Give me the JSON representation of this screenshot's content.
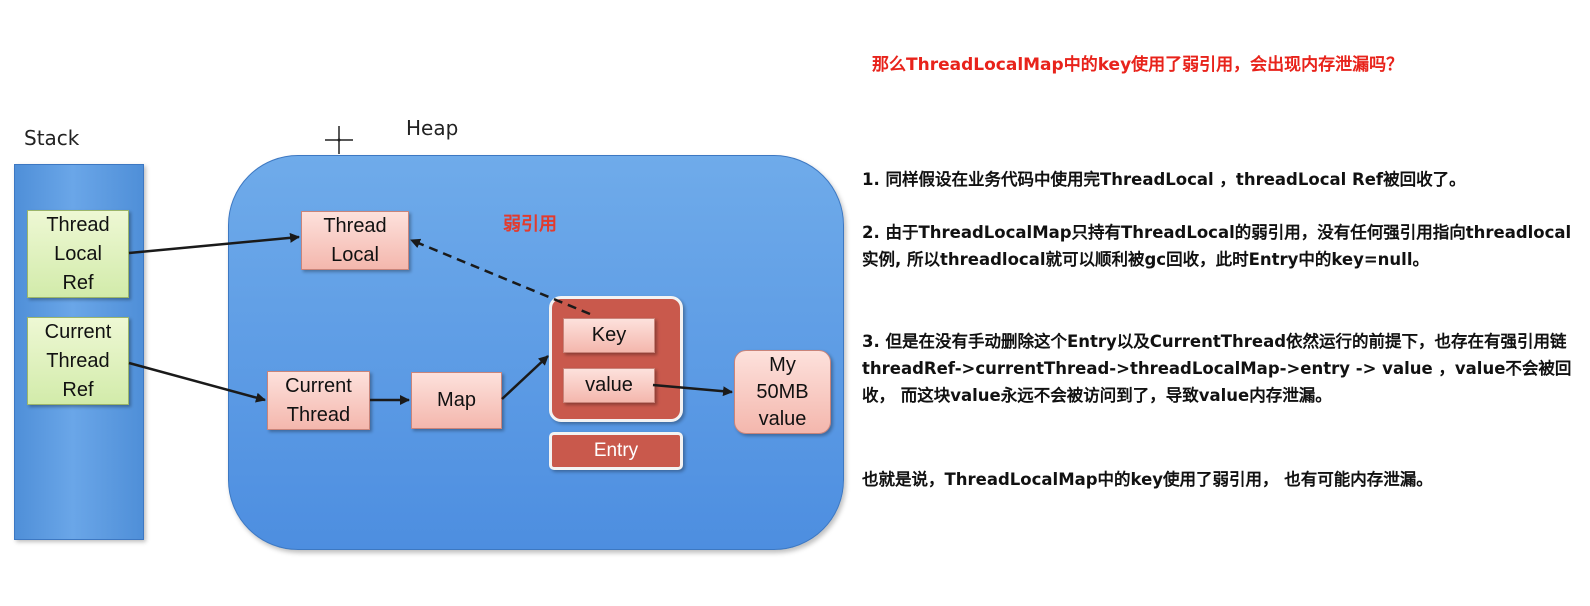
{
  "diagram": {
    "stack_title": "Stack",
    "heap_title": "Heap",
    "weak_ref_label": "弱引用",
    "stack_items": [
      {
        "label": "Thread\nLocal\nRef"
      },
      {
        "label": "Current\nThread\nRef"
      }
    ],
    "heap_items": {
      "thread_local": "Thread\nLocal",
      "current_thread": "Current\nThread",
      "map": "Map",
      "key": "Key",
      "value": "value",
      "entry": "Entry",
      "my_value": "My\n50MB\nvalue"
    }
  },
  "text_panel": {
    "question": "那么ThreadLocalMap中的key使用了弱引用，会出现内存泄漏吗？",
    "paragraphs": [
      "1. 同样假设在业务代码中使用完ThreadLocal ，threadLocal Ref被回收了。",
      "2. 由于ThreadLocalMap只持有ThreadLocal的弱引用，没有任何强引用指向threadlocal实例, 所以threadlocal就可以顺利被gc回收，此时Entry中的key=null。",
      "3. 但是在没有手动删除这个Entry以及CurrentThread依然运行的前提下，也存在有强引用链 threadRef->currentThread->threadLocalMap->entry -> value ，value不会被回收， 而这块value永远不会被访问到了，导致value内存泄漏。",
      "也就是说，ThreadLocalMap中的key使用了弱引用， 也有可能内存泄漏。"
    ]
  },
  "colors": {
    "heap_blue": "#4d8ee0",
    "green_box": "#d2ebaa",
    "pink_box": "#f4b7ad",
    "entry_red": "#c9594c",
    "question_red": "#e8231b"
  }
}
